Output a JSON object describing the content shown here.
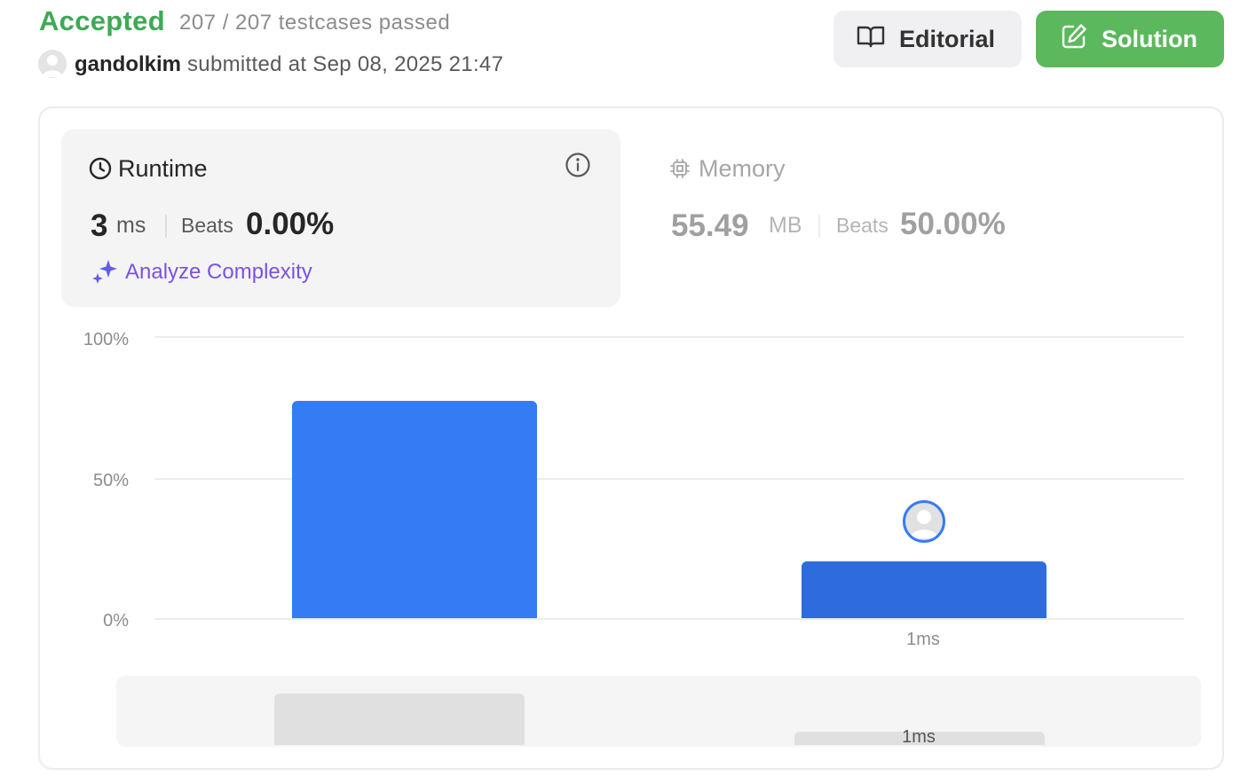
{
  "header": {
    "status": "Accepted",
    "testcases": "207 / 207 testcases passed",
    "username": "gandolkim",
    "submitted_text": "submitted at Sep 08, 2025 21:47",
    "editorial_label": "Editorial",
    "solution_label": "Solution"
  },
  "runtime": {
    "title": "Runtime",
    "value": "3",
    "unit": "ms",
    "beats_label": "Beats",
    "beats_value": "0.00%",
    "analyze_label": "Analyze Complexity"
  },
  "memory": {
    "title": "Memory",
    "value": "55.49",
    "unit": "MB",
    "beats_label": "Beats",
    "beats_value": "50.00%"
  },
  "icons": [
    "book-open-icon",
    "edit-icon",
    "clock-icon",
    "info-icon",
    "sparkle-icon",
    "cpu-chip-icon",
    "user-avatar-icon"
  ],
  "colors": {
    "accepted": "#3daa55",
    "solution_button": "#5cb85c",
    "bar": "#357cf4",
    "analyze": "#7a53e0"
  },
  "chart_data": {
    "type": "bar",
    "categories": [
      "",
      "1ms"
    ],
    "values": [
      77,
      20
    ],
    "yticks": [
      "100%",
      "50%",
      "0%"
    ],
    "ylim": [
      0,
      100
    ],
    "grid": true,
    "marker_category": "1ms",
    "minimap_label": "1ms"
  }
}
